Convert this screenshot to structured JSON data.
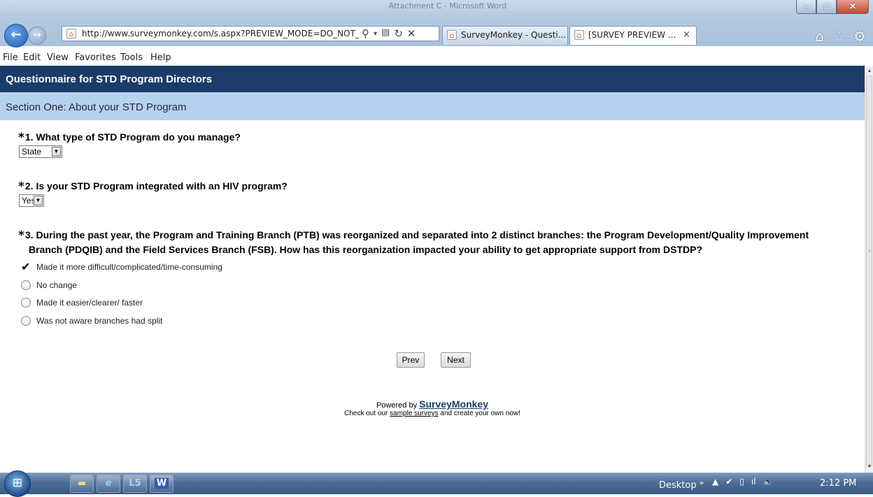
{
  "browser": {
    "window_title": "Attachment C - Microsoft Word",
    "address_url": "http://www.surveymonkey.com/s.aspx?PREVIEW_MODE=DO_NOT_",
    "tabs": [
      {
        "label": "SurveyMonkey - Questi...",
        "active": false
      },
      {
        "label": "[SURVEY PREVIEW ...",
        "active": true
      }
    ],
    "menu": [
      "File",
      "Edit",
      "View",
      "Favorites",
      "Tools",
      "Help"
    ]
  },
  "survey": {
    "title": "Questionnaire for STD Program Directors",
    "section": "Section One: About your STD Program",
    "questions": [
      {
        "number": "1.",
        "text": "What type of STD Program do you manage?",
        "required": true,
        "type": "dropdown",
        "value": "State"
      },
      {
        "number": "2.",
        "text": "Is your STD Program integrated with an HIV program?",
        "required": true,
        "type": "dropdown",
        "value": "Yes"
      },
      {
        "number": "3.",
        "text_line1": "During the past year, the Program and Training Branch (PTB) was reorganized and separated into 2 distinct branches: the Program Development/Quality Improvement",
        "text_line2": "Branch (PDQIB) and the Field Services Branch (FSB). How has this reorganization impacted your ability to get appropriate support from DSTDP?",
        "required": true,
        "type": "radio",
        "options": [
          {
            "label": "Made it more difficult/complicated/time-consuming",
            "selected": true
          },
          {
            "label": "No change",
            "selected": false
          },
          {
            "label": "Made it easier/clearer/ faster",
            "selected": false
          },
          {
            "label": "Was not aware branches had split",
            "selected": false
          }
        ]
      }
    ],
    "buttons": {
      "prev": "Prev",
      "next": "Next"
    },
    "footer": {
      "powered_by": "Powered by",
      "brand": "SurveyMonkey",
      "line2_prefix": "Check out our",
      "line2_link": "sample surveys",
      "line2_suffix": "and create your own now!"
    }
  },
  "taskbar": {
    "desktop_label": "Desktop",
    "clock": "2:12 PM",
    "apps": [
      "folder-icon",
      "internet-explorer-icon",
      "l5-icon",
      "word-icon"
    ]
  },
  "colors": {
    "survey_header": "#1b3c6a",
    "section_header": "#b8d1f1"
  }
}
